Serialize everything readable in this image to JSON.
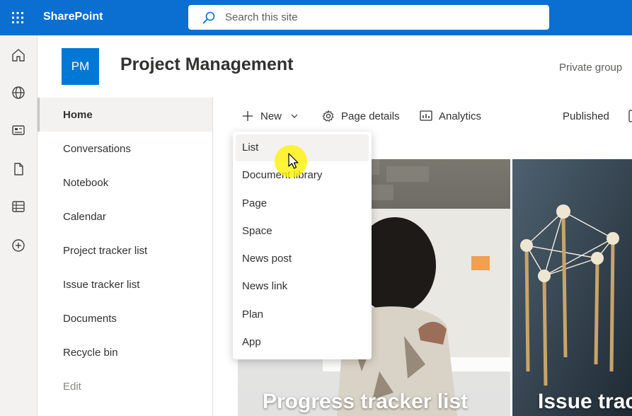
{
  "topbar": {
    "app_name": "SharePoint",
    "search_placeholder": "Search this site"
  },
  "rail": {
    "items": [
      "home-icon",
      "globe-icon",
      "news-icon",
      "file-icon",
      "list-icon",
      "add-icon"
    ]
  },
  "site": {
    "logo_initials": "PM",
    "title": "Project Management",
    "privacy": "Private group"
  },
  "leftnav": {
    "items": [
      {
        "label": "Home",
        "active": true
      },
      {
        "label": "Conversations"
      },
      {
        "label": "Notebook"
      },
      {
        "label": "Calendar"
      },
      {
        "label": "Project tracker list"
      },
      {
        "label": "Issue tracker list"
      },
      {
        "label": "Documents"
      },
      {
        "label": "Recycle bin"
      },
      {
        "label": "Edit"
      }
    ]
  },
  "commandbar": {
    "new": "New",
    "page_details": "Page details",
    "analytics": "Analytics",
    "status": "Published"
  },
  "new_menu": {
    "items": [
      "List",
      "Document library",
      "Page",
      "Space",
      "News post",
      "News link",
      "Plan",
      "App"
    ],
    "highlighted": "List"
  },
  "hero": {
    "tile1_caption": "Progress tracker list",
    "tile2_caption": "Issue trac"
  },
  "colors": {
    "suite_bar": "#0a6fd0",
    "logo": "#0078d4",
    "nav_bg": "#f3f2f1"
  }
}
